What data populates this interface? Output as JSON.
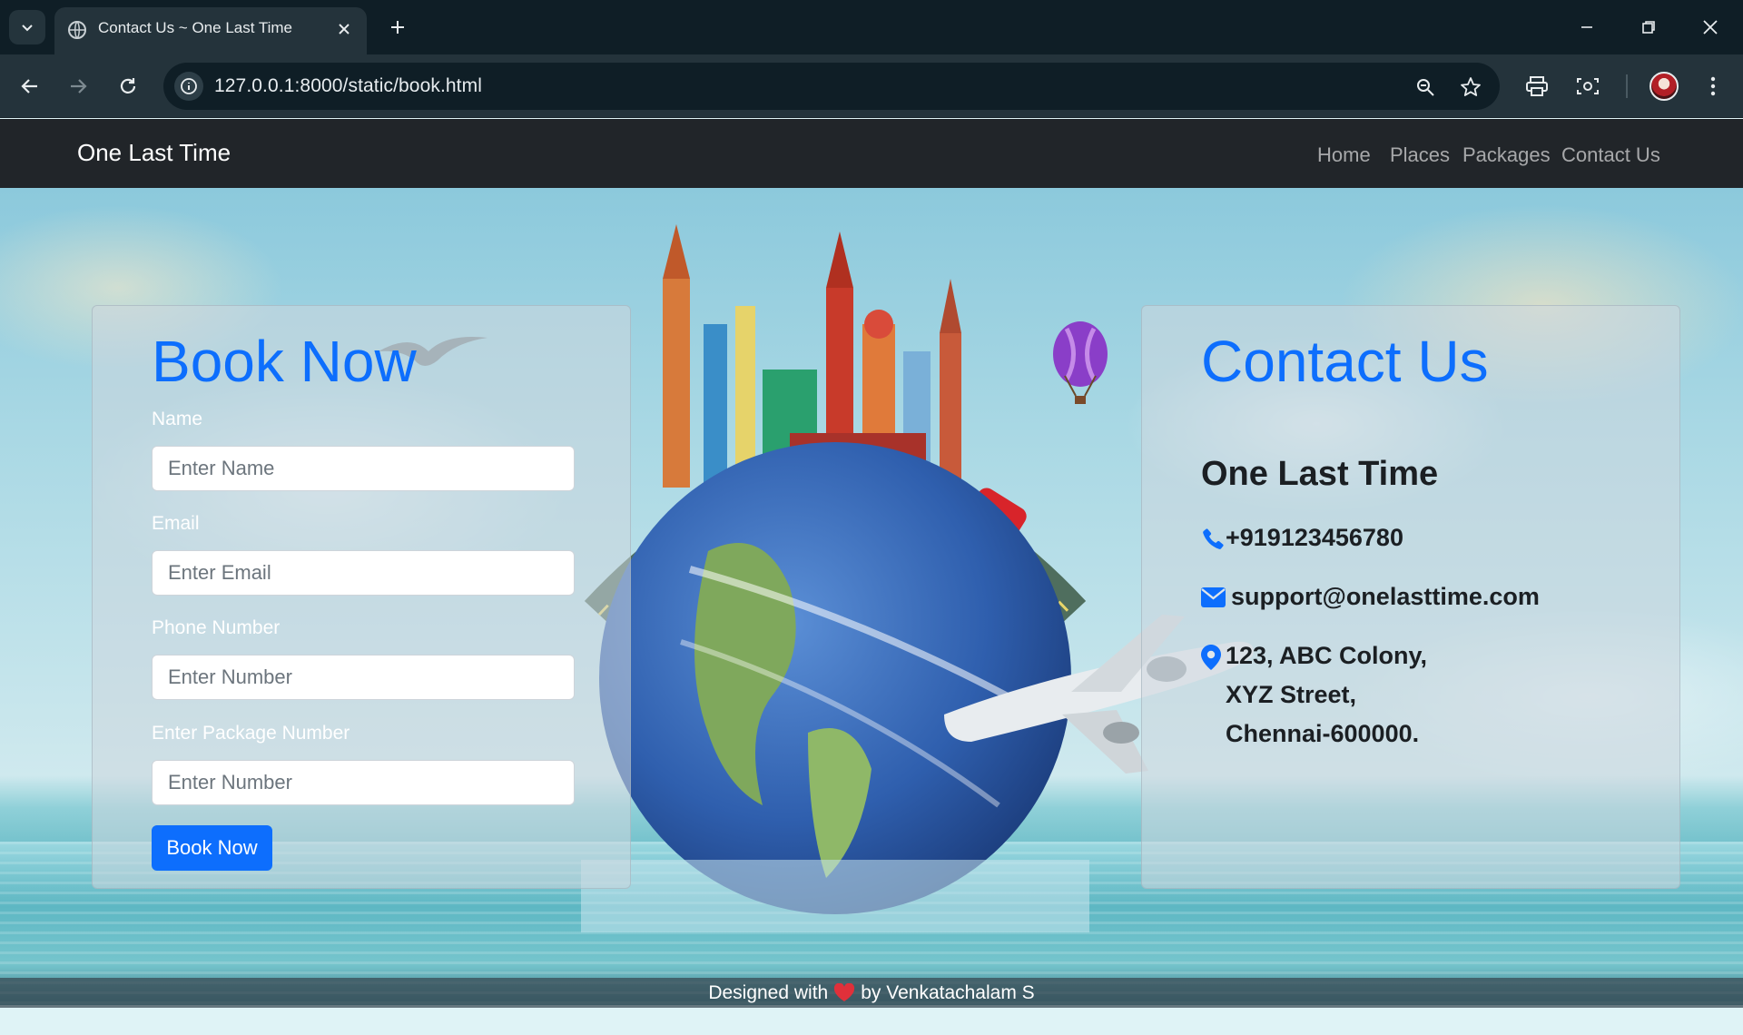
{
  "browser": {
    "tab_title": "Contact Us ~ One Last Time",
    "url": "127.0.0.1:8000/static/book.html",
    "icons": [
      "tab-search-icon",
      "globe-favicon-icon",
      "close-icon",
      "plus-icon",
      "minimize-icon",
      "restore-icon",
      "window-close-icon",
      "back-icon",
      "forward-icon",
      "reload-icon",
      "site-info-icon",
      "zoom-icon",
      "bookmark-star-icon",
      "print-icon",
      "screenshot-icon",
      "kebab-menu-icon"
    ]
  },
  "navbar": {
    "brand": "One Last Time",
    "links": [
      "Home",
      "Places",
      "Packages",
      "Contact Us"
    ]
  },
  "book_form": {
    "title": "Book Now",
    "fields": [
      {
        "label": "Name",
        "placeholder": "Enter Name"
      },
      {
        "label": "Email",
        "placeholder": "Enter Email"
      },
      {
        "label": "Phone Number",
        "placeholder": "Enter Number"
      },
      {
        "label": "Enter Package Number",
        "placeholder": "Enter Number"
      }
    ],
    "submit_label": "Book Now"
  },
  "contact": {
    "title": "Contact Us",
    "org_name": "One Last Time",
    "phone": "+919123456780",
    "email": "support@onelasttime.com",
    "address_lines": [
      "123, ABC Colony,",
      "XYZ Street,",
      "Chennai-600000."
    ]
  },
  "footer": {
    "prefix": "Designed with",
    "suffix": "by Venkatachalam S",
    "heart_color": "#e0303a"
  },
  "colors": {
    "primary": "#0d6efd",
    "navbar_bg": "#212529",
    "chrome_bg": "#0f1e26"
  }
}
